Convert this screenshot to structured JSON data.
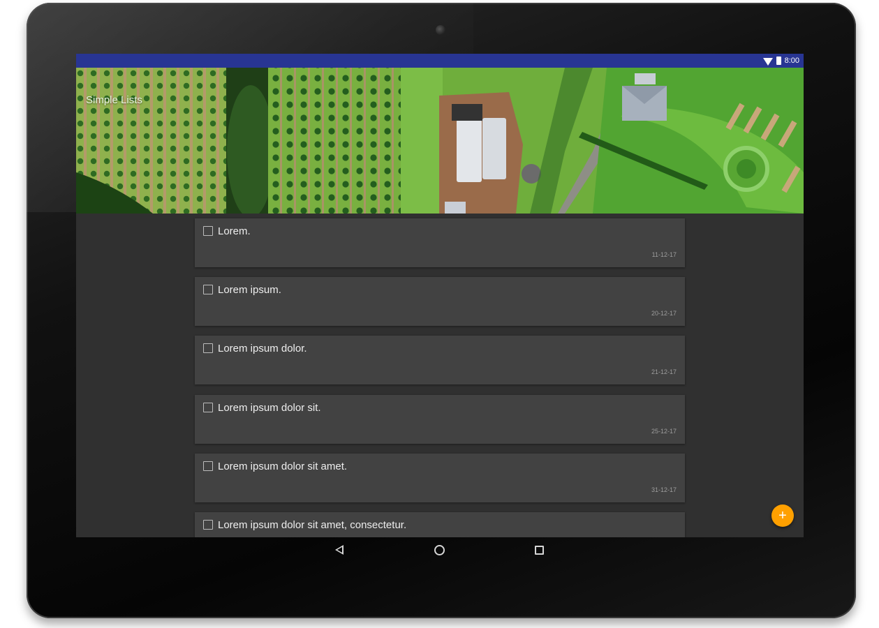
{
  "status_bar": {
    "time": "8:00"
  },
  "app": {
    "title": "Simple Lists"
  },
  "items": [
    {
      "title": "Lorem.",
      "date": "11-12-17",
      "checked": false
    },
    {
      "title": "Lorem ipsum.",
      "date": "20-12-17",
      "checked": false
    },
    {
      "title": "Lorem ipsum dolor.",
      "date": "21-12-17",
      "checked": false
    },
    {
      "title": "Lorem ipsum dolor sit.",
      "date": "25-12-17",
      "checked": false
    },
    {
      "title": "Lorem ipsum dolor sit amet.",
      "date": "31-12-17",
      "checked": false
    },
    {
      "title": "Lorem ipsum dolor sit amet, consectetur.",
      "date": "",
      "checked": false
    }
  ],
  "fab": {
    "icon": "plus-icon",
    "label": "+"
  },
  "nav_bar": {
    "back_icon": "back-icon",
    "home_icon": "home-icon",
    "recents_icon": "recents-icon"
  },
  "colors": {
    "status_bar": "#283593",
    "background": "#303030",
    "card": "#424242",
    "fab": "#ffa000"
  }
}
